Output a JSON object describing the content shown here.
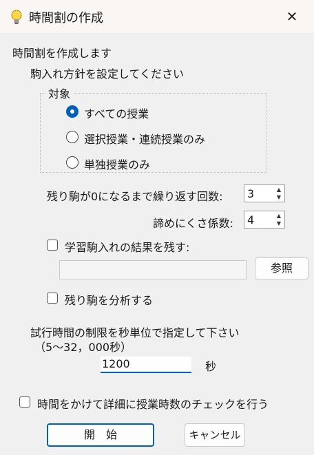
{
  "window": {
    "title": "時間割の作成",
    "close": "✕"
  },
  "intro": "時間割を作成します",
  "policy_heading": "駒入れ方針を設定してください",
  "target_group": {
    "title": "対象",
    "options": [
      "すべての授業",
      "選択授業・連続授業のみ",
      "単独授業のみ"
    ],
    "selected_index": 0
  },
  "repeat_count": {
    "label": "残り駒が0になるまで繰り返す回数:",
    "value": "3"
  },
  "give_up_factor": {
    "label": "諦めにくさ係数:",
    "value": "4"
  },
  "keep_result": {
    "label": "学習駒入れの結果を残す:",
    "checked": false,
    "path_value": "",
    "browse_label": "参照"
  },
  "analyze": {
    "label": "残り駒を分析する",
    "checked": false
  },
  "time_limit": {
    "line1": "試行時間の制限を秒単位で指定して下さい",
    "line2": "（5～32，000秒）",
    "value": "1200",
    "unit": "秒"
  },
  "detail_check": {
    "label": "時間をかけて詳細に授業時数のチェックを行う",
    "checked": false
  },
  "buttons": {
    "start": "開　始",
    "cancel": "キャンセル"
  },
  "colors": {
    "accent": "#005fb8",
    "background": "#f0f0f0",
    "titlebar": "#faf6f3"
  }
}
